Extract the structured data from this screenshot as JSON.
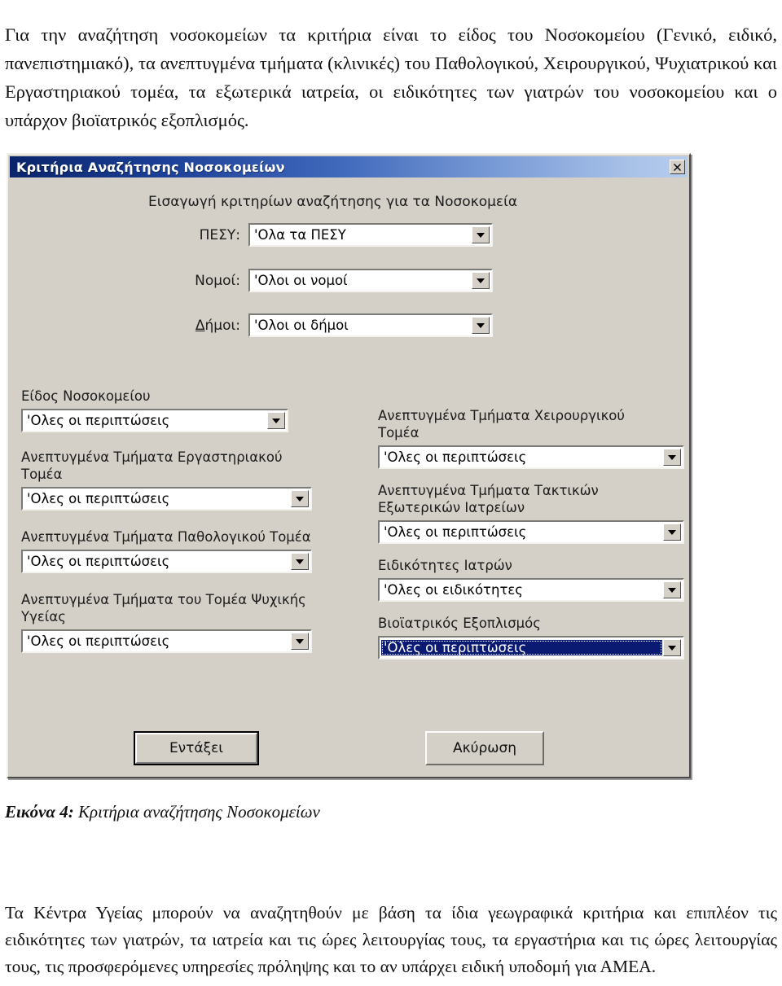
{
  "document": {
    "intro_paragraph": "Για την αναζήτηση νοσοκομείων τα κριτήρια είναι το είδος του Νοσοκομείου (Γενικό, ειδικό, πανεπιστημιακό), τα ανεπτυγμένα τμήματα (κλινικές) του Παθολογικού, Χειρουργικού, Ψυχιατρικού και Εργαστηριακού τομέα, τα εξωτερικά ιατρεία, οι ειδικότητες των γιατρών του νοσοκομείου και ο υπάρχον βιοϊατρικός εξοπλισμός.",
    "figure_caption_label": "Εικόνα 4:",
    "figure_caption_text": " Κριτήρια αναζήτησης Νοσοκομείων",
    "closing_paragraph": "Τα Κέντρα Υγείας μπορούν να αναζητηθούν με βάση τα ίδια γεωγραφικά κριτήρια και επιπλέον τις ειδικότητες των γιατρών, τα ιατρεία και τις ώρες λειτουργίας τους, τα εργαστήρια και τις ώρες λειτουργίας τους, τις προσφερόμενες υπηρεσίες πρόληψης και το αν υπάρχει ειδική υποδομή για ΑΜΕΑ."
  },
  "dialog": {
    "title": "Κριτήρια Αναζήτησης Νοσοκομείων",
    "close_icon": "close-icon",
    "header_prompt": "Εισαγωγή κριτηρίων αναζήτησης για τα Νοσοκομεία",
    "colors": {
      "face": "#d4d0c8",
      "titlebar_start": "#0a246a",
      "titlebar_end": "#b7cdee",
      "selection": "#0a1a72",
      "field": "#ffffff"
    },
    "geo_fields": [
      {
        "label": "ΠΕΣΥ:",
        "value": "'Ολα τα ΠΕΣΥ",
        "arrow_icon": "chevron-down-icon"
      },
      {
        "label": "Νομοί:",
        "value": "'Ολοι οι νομοί",
        "arrow_icon": "chevron-down-icon"
      },
      {
        "label": "Δήμοι:",
        "accel": "Δ",
        "label_rest": "ήμοι:",
        "value": "'Ολοι οι δήμοι",
        "arrow_icon": "chevron-down-icon"
      }
    ],
    "left_column": [
      {
        "label": "Είδος Νοσοκομείου",
        "value": "'Ολες οι περιπτώσεις",
        "arrow_icon": "chevron-down-icon"
      },
      {
        "label": "Ανεπτυγμένα Τμήματα Εργαστηριακού\nΤομέα",
        "value": "'Ολες οι περιπτώσεις",
        "arrow_icon": "chevron-down-icon"
      },
      {
        "label": "Ανεπτυγμένα Τμήματα Παθολογικού Τομέα",
        "value": "'Ολες οι περιπτώσεις",
        "arrow_icon": "chevron-down-icon"
      },
      {
        "label": "Ανεπτυγμένα Τμήματα του Τομέα Ψυχικής\nΥγείας",
        "value": "'Ολες οι περιπτώσεις",
        "arrow_icon": "chevron-down-icon"
      }
    ],
    "right_column": [
      {
        "label": "Ανεπτυγμένα Τμήματα Χειρουργικού\nΤομέα",
        "value": "'Ολες οι περιπτώσεις",
        "arrow_icon": "chevron-down-icon"
      },
      {
        "label": "Ανεπτυγμένα Τμήματα Τακτικών\nΕξωτερικών Ιατρείων",
        "value": "'Ολες οι περιπτώσεις",
        "arrow_icon": "chevron-down-icon"
      },
      {
        "label": "Ειδικότητες Ιατρών",
        "value": "'Ολες οι ειδικότητες",
        "arrow_icon": "chevron-down-icon"
      },
      {
        "label": "Βιοϊατρικός Εξοπλισμός",
        "value": "'Ολες οι περιπτώσεις",
        "arrow_icon": "chevron-down-icon",
        "focused": true
      }
    ],
    "buttons": {
      "ok": "Εντάξει",
      "cancel": "Ακύρωση"
    }
  }
}
